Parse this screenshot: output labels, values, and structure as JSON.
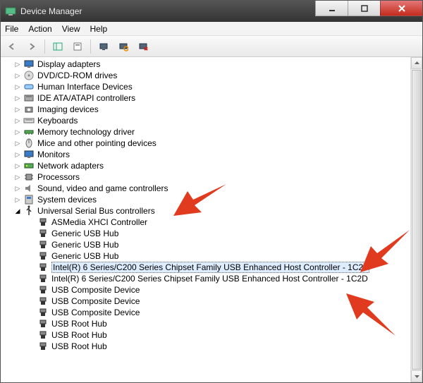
{
  "window": {
    "title": "Device Manager"
  },
  "menu": {
    "items": [
      "File",
      "Action",
      "View",
      "Help"
    ]
  },
  "toolbar": {
    "icons": [
      "back",
      "forward",
      "view-pane",
      "hardware",
      "monitor",
      "scan",
      "help-device"
    ]
  },
  "tree": [
    {
      "label": "Display adapters",
      "icon": "display",
      "expanded": false
    },
    {
      "label": "DVD/CD-ROM drives",
      "icon": "dvd",
      "expanded": false
    },
    {
      "label": "Human Interface Devices",
      "icon": "hid",
      "expanded": false
    },
    {
      "label": "IDE ATA/ATAPI controllers",
      "icon": "ide",
      "expanded": false
    },
    {
      "label": "Imaging devices",
      "icon": "imaging",
      "expanded": false
    },
    {
      "label": "Keyboards",
      "icon": "keyboard",
      "expanded": false
    },
    {
      "label": "Memory technology driver",
      "icon": "memory",
      "expanded": false
    },
    {
      "label": "Mice and other pointing devices",
      "icon": "mouse",
      "expanded": false
    },
    {
      "label": "Monitors",
      "icon": "monitor",
      "expanded": false
    },
    {
      "label": "Network adapters",
      "icon": "network",
      "expanded": false
    },
    {
      "label": "Processors",
      "icon": "cpu",
      "expanded": false
    },
    {
      "label": "Sound, video and game controllers",
      "icon": "sound",
      "expanded": false
    },
    {
      "label": "System devices",
      "icon": "system",
      "expanded": false
    },
    {
      "label": "Universal Serial Bus controllers",
      "icon": "usb",
      "expanded": true,
      "children": [
        {
          "label": "ASMedia XHCI Controller",
          "icon": "usb-plug"
        },
        {
          "label": "Generic USB Hub",
          "icon": "usb-plug"
        },
        {
          "label": "Generic USB Hub",
          "icon": "usb-plug"
        },
        {
          "label": "Generic USB Hub",
          "icon": "usb-plug"
        },
        {
          "label": "Intel(R) 6 Series/C200 Series Chipset Family USB Enhanced Host Controller - 1C26",
          "icon": "usb-plug",
          "selected": true
        },
        {
          "label": "Intel(R) 6 Series/C200 Series Chipset Family USB Enhanced Host Controller - 1C2D",
          "icon": "usb-plug"
        },
        {
          "label": "USB Composite Device",
          "icon": "usb-plug"
        },
        {
          "label": "USB Composite Device",
          "icon": "usb-plug"
        },
        {
          "label": "USB Composite Device",
          "icon": "usb-plug"
        },
        {
          "label": "USB Root Hub",
          "icon": "usb-plug"
        },
        {
          "label": "USB Root Hub",
          "icon": "usb-plug"
        },
        {
          "label": "USB Root Hub",
          "icon": "usb-plug"
        }
      ]
    }
  ],
  "annotation_color": "#e03b1f"
}
